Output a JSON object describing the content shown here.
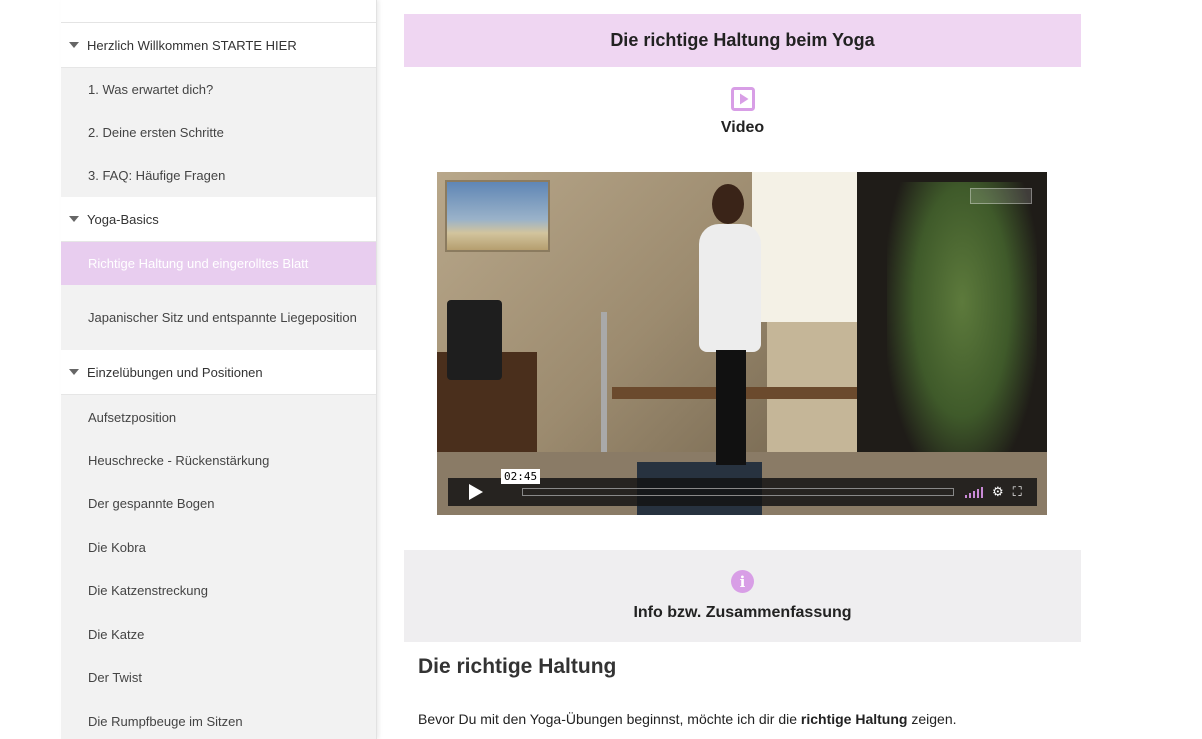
{
  "sidebar": {
    "sections": [
      {
        "title": "Herzlich Willkommen STARTE HIER",
        "lessons": [
          "1. Was erwartet dich?",
          "2. Deine ersten Schritte",
          "3. FAQ: Häufige Fragen"
        ]
      },
      {
        "title": "Yoga-Basics",
        "lessons": [
          "Richtige Haltung und eingerolltes Blatt",
          "Japanischer Sitz und entspannte Liegeposition"
        ]
      },
      {
        "title": "Einzelübungen und Positionen",
        "lessons": [
          "Aufsetzposition",
          "Heuschrecke - Rückenstärkung",
          "Der gespannte Bogen",
          "Die Kobra",
          "Die Katzenstreckung",
          "Die Katze",
          "Der Twist",
          "Die Rumpfbeuge im Sitzen"
        ]
      }
    ],
    "active_lesson": "Richtige Haltung und eingerolltes Blatt"
  },
  "main": {
    "title": "Die richtige Haltung beim Yoga",
    "video_label": "Video",
    "video": {
      "timestamp": "02:45",
      "play_icon": "play-icon",
      "settings_icon": "gear-icon",
      "fullscreen_icon": "fullscreen-icon"
    },
    "info_label": "Info bzw. Zusammenfassung",
    "content_heading": "Die richtige Haltung",
    "paragraph_prefix": "Bevor Du mit den Yoga-Übungen beginnst, möchte ich dir die ",
    "paragraph_bold": "richtige Haltung",
    "paragraph_suffix": " zeigen."
  },
  "colors": {
    "accent": "#e8cdef",
    "title_bar": "#efd6f2",
    "icon": "#d89ee6"
  }
}
